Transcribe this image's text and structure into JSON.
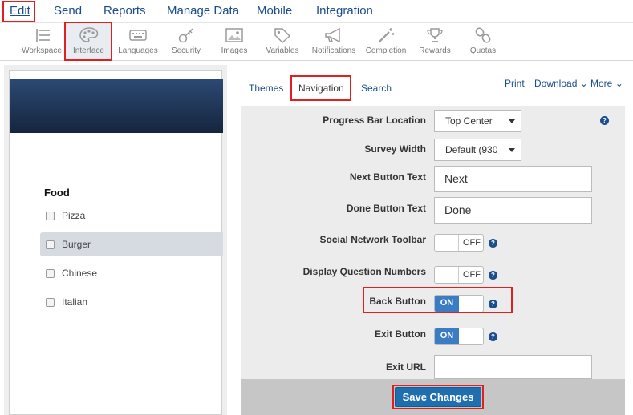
{
  "menu": [
    "Edit",
    "Send",
    "Reports",
    "Manage Data",
    "Mobile",
    "Integration"
  ],
  "toolbar": [
    {
      "label": "Workspace",
      "icon": "list-icon"
    },
    {
      "label": "Interface",
      "icon": "palette-icon"
    },
    {
      "label": "Languages",
      "icon": "keyboard-icon"
    },
    {
      "label": "Security",
      "icon": "key-icon"
    },
    {
      "label": "Images",
      "icon": "image-icon"
    },
    {
      "label": "Variables",
      "icon": "tag-icon"
    },
    {
      "label": "Notifications",
      "icon": "megaphone-icon"
    },
    {
      "label": "Completion",
      "icon": "magic-wand-icon"
    },
    {
      "label": "Rewards",
      "icon": "trophy-icon"
    },
    {
      "label": "Quotas",
      "icon": "link-icon"
    }
  ],
  "preview": {
    "question": "Food",
    "options": [
      "Pizza",
      "Burger",
      "Chinese",
      "Italian"
    ],
    "highlighted_option": "Burger"
  },
  "tabs": {
    "themes": "Themes",
    "navigation": "Navigation",
    "search": "Search"
  },
  "actions": {
    "print": "Print",
    "download": "Download",
    "more": "More"
  },
  "settings": {
    "progress_bar_location": {
      "label": "Progress Bar Location",
      "value": "Top Center"
    },
    "survey_width": {
      "label": "Survey Width",
      "value": "Default (930"
    },
    "next_button_text": {
      "label": "Next Button Text",
      "value": "Next"
    },
    "done_button_text": {
      "label": "Done Button Text",
      "value": "Done"
    },
    "social_network_toolbar": {
      "label": "Social Network Toolbar",
      "state": "OFF"
    },
    "display_question_numbers": {
      "label": "Display Question Numbers",
      "state": "OFF"
    },
    "back_button": {
      "label": "Back Button",
      "state": "ON"
    },
    "exit_button": {
      "label": "Exit Button",
      "state": "ON"
    },
    "exit_url": {
      "label": "Exit URL",
      "value": ""
    }
  },
  "help_glyph": "?",
  "save_label": "Save Changes",
  "colors": {
    "accent": "#1a4d8c",
    "highlight_box": "#e02020",
    "toggle_on": "#3b7dc4",
    "save_button": "#1f6fb0"
  }
}
